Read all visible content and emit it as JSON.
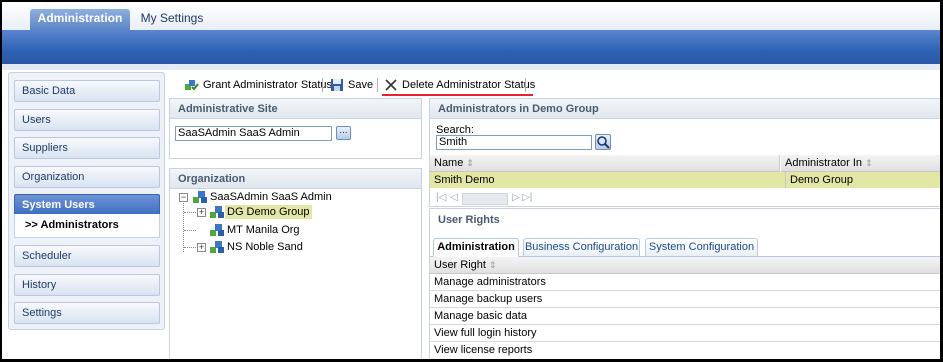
{
  "top_tabs": {
    "administration": "Administration",
    "my_settings": "My Settings"
  },
  "sidebar": {
    "items": [
      {
        "label": "Basic Data"
      },
      {
        "label": "Users"
      },
      {
        "label": "Suppliers"
      },
      {
        "label": "Organization"
      },
      {
        "label": "System Users"
      },
      {
        "label": "Scheduler"
      },
      {
        "label": "History"
      },
      {
        "label": "Settings"
      }
    ],
    "sub_item": ">> Administrators"
  },
  "toolbar": {
    "grant_label": "Grant Administrator Status",
    "save_label": "Save",
    "delete_label": "Delete Administrator Status"
  },
  "admin_site": {
    "title": "Administrative Site",
    "value": "SaaSAdmin SaaS Admin",
    "browse_label": "..."
  },
  "organization": {
    "title": "Organization",
    "root": "SaaSAdmin SaaS Admin",
    "children": [
      "DG Demo Group",
      "MT Manila Org",
      "NS Noble Sand"
    ]
  },
  "admins": {
    "title": "Administrators in Demo Group",
    "search_label": "Search:",
    "search_value": "Smith",
    "columns": [
      "Name",
      "Administrator In"
    ],
    "rows": [
      {
        "name": "Smith Demo",
        "admin_in": "Demo Group"
      }
    ]
  },
  "user_rights": {
    "title": "User Rights",
    "tabs": [
      "Administration",
      "Business Configuration",
      "System Configuration"
    ],
    "column": "User Right",
    "rows": [
      "Manage administrators",
      "Manage backup users",
      "Manage basic data",
      "View full login history",
      "View license reports"
    ]
  },
  "colors": {
    "accent": "#2f62b5",
    "selected_row": "#e2e7a6",
    "highlight": "#e8202a"
  }
}
